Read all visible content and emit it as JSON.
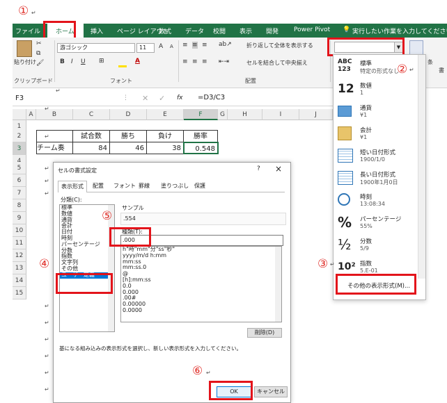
{
  "annotations": [
    "①",
    "②",
    "③",
    "④",
    "⑤",
    "⑥"
  ],
  "ribbon": {
    "tabs": [
      "ファイル",
      "ホーム",
      "挿入",
      "ページ レイアウト",
      "数式",
      "データ",
      "校閲",
      "表示",
      "開発",
      "Power Pivot"
    ],
    "tell_me": "実行したい作業を入力してください...",
    "paste_label": "貼り付け",
    "font_name": "游ゴシック",
    "font_size": "11",
    "wrap_text": "折り返して全体を表示する",
    "merge_center": "セルを結合して中央揃え",
    "groups": [
      "クリップボード",
      "フォント",
      "配置"
    ],
    "bold": "B",
    "italic": "I",
    "underline": "U",
    "grow": "A",
    "shrink": "A",
    "right_edge": "条",
    "right_edge2": "書"
  },
  "formula_bar": {
    "name_box": "F3",
    "fx": "fx",
    "formula": "=D3/C3"
  },
  "grid": {
    "columns": [
      "A",
      "B",
      "C",
      "D",
      "E",
      "F",
      "G",
      "H",
      "I",
      "J"
    ],
    "rows": [
      "1",
      "2",
      "3",
      "4",
      "5",
      "6",
      "7",
      "8",
      "9",
      "10",
      "11",
      "12",
      "13",
      "14",
      "15"
    ],
    "header_row": [
      "",
      "試合数",
      "勝ち",
      "負け",
      "勝率"
    ],
    "data_row": [
      "チーム奏",
      "84",
      "46",
      "38",
      "0.548"
    ]
  },
  "dialog": {
    "title": "セルの書式設定",
    "help": "?",
    "close": "×",
    "tabs": [
      "表示形式",
      "配置",
      "フォント",
      "罫線",
      "塗りつぶし",
      "保護"
    ],
    "category_label": "分類(C):",
    "categories": [
      "標準",
      "数値",
      "通貨",
      "会計",
      "日付",
      "時刻",
      "パーセンテージ",
      "分数",
      "指数",
      "文字列",
      "その他",
      "ユーザー定義"
    ],
    "sample_label": "サンプル",
    "sample_value": ".554",
    "type_label": "種類(T):",
    "type_value": ".000",
    "formats": [
      "h\"時\"mm\"分\"ss\"秒\"",
      "yyyy/m/d h:mm",
      "mm:ss",
      "mm:ss.0",
      "@",
      "[h]:mm:ss",
      "0.0",
      "0.000",
      ".00#",
      "0.00000",
      "0.0000"
    ],
    "delete_button": "削除(D)",
    "description": "基になる組み込みの表示形式を選択し、新しい表示形式を入力してください。",
    "ok": "OK",
    "cancel": "キャンセル"
  },
  "format_dropdown": {
    "items": [
      {
        "icon": "ABC 123",
        "name": "標準",
        "sample": "特定の形式なし"
      },
      {
        "icon": "12",
        "name": "数値",
        "sample": "1"
      },
      {
        "icon": "currency-icon",
        "name": "通貨",
        "sample": "¥1"
      },
      {
        "icon": "accounting-icon",
        "name": "会計",
        "sample": "¥1"
      },
      {
        "icon": "calendar-icon",
        "name": "短い日付形式",
        "sample": "1900/1/0"
      },
      {
        "icon": "calendar-icon",
        "name": "長い日付形式",
        "sample": "1900年1月0日"
      },
      {
        "icon": "clock-icon",
        "name": "時刻",
        "sample": "13:08:34"
      },
      {
        "icon": "%",
        "name": "パーセンテージ",
        "sample": "55%"
      },
      {
        "icon": "½",
        "name": "分数",
        "sample": "5/9"
      },
      {
        "icon": "10²",
        "name": "指数",
        "sample": "5.E-01"
      }
    ],
    "more": "その他の表示形式(M)..."
  },
  "colors": {
    "excel_green": "#217346",
    "annotation_red": "#e3141b"
  }
}
